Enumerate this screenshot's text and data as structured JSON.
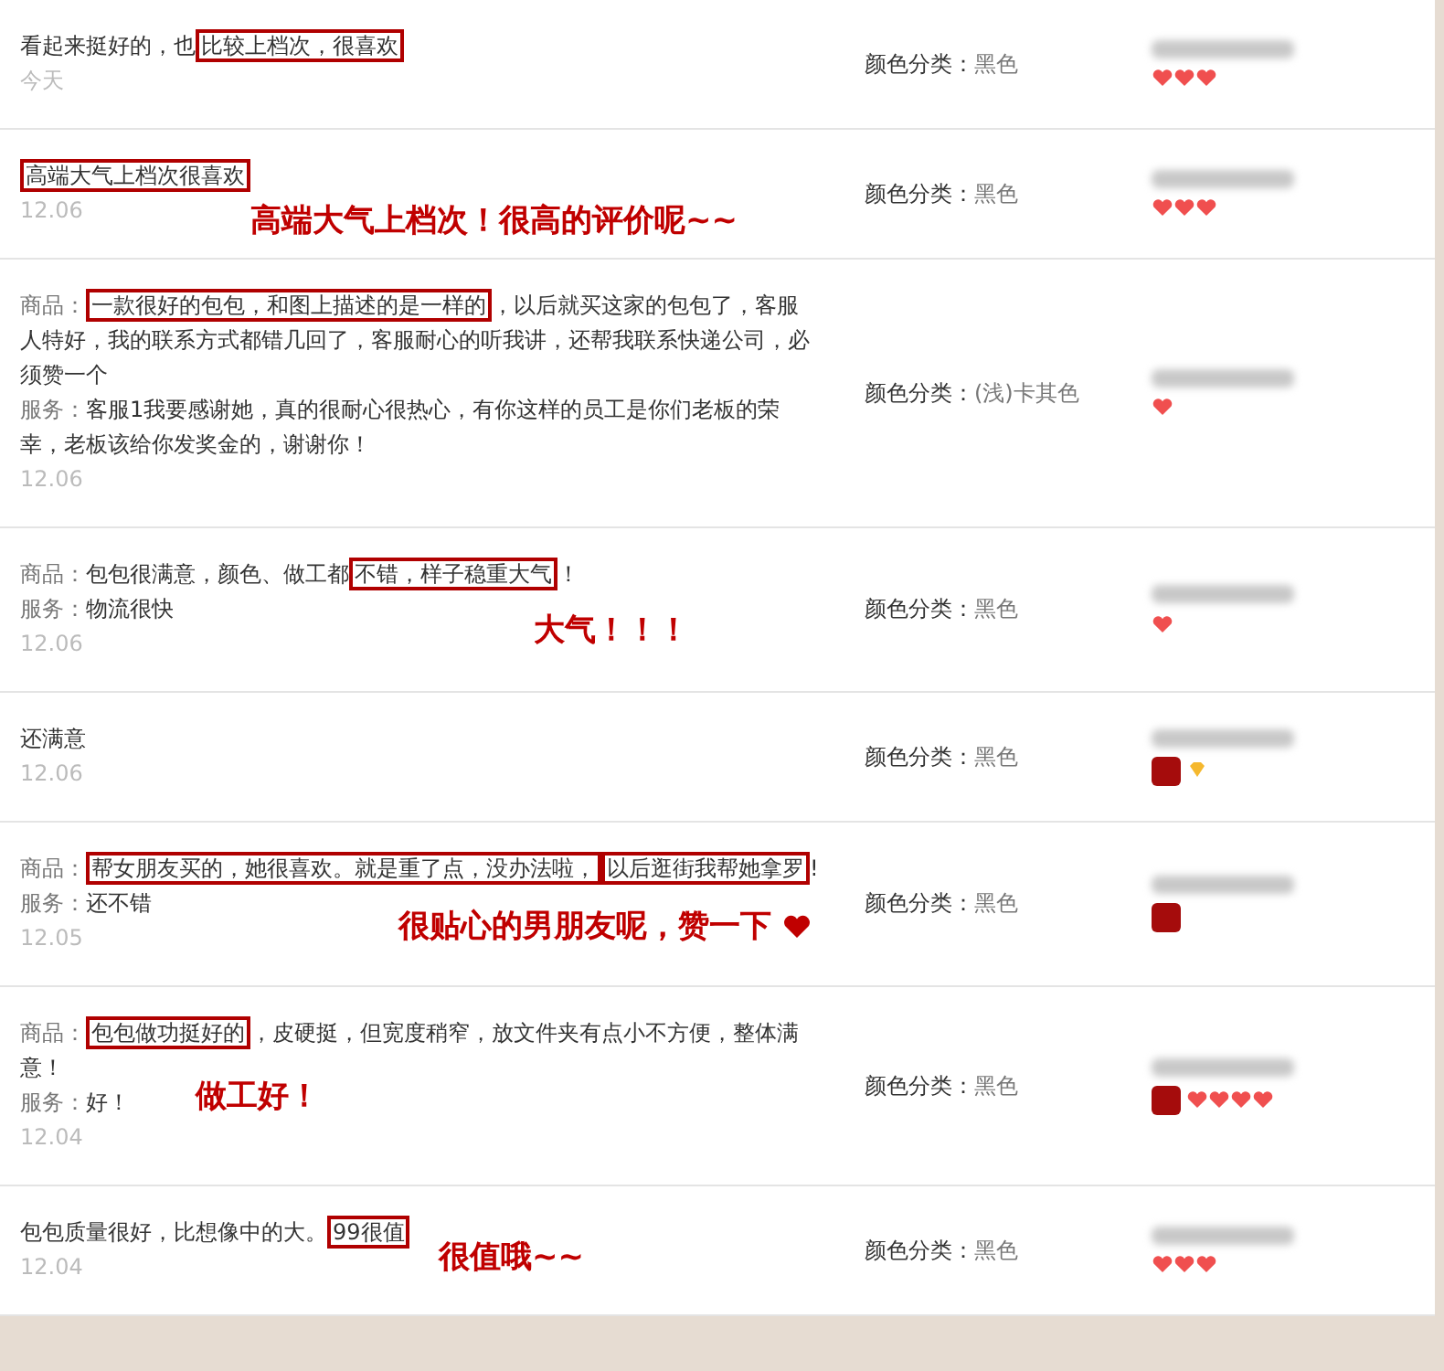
{
  "reviews": [
    {
      "segments": [
        {
          "text": "看起来挺好的，也"
        },
        {
          "text": "比较上档次，很喜欢",
          "boxed": true
        }
      ],
      "date": "今天",
      "color_label": "颜色分类：",
      "color_value": "黑色",
      "rank_icons": [
        {
          "kind": "heart"
        },
        {
          "kind": "heart"
        },
        {
          "kind": "heart"
        }
      ]
    },
    {
      "segments": [
        {
          "text": "高端大气上档次很喜欢",
          "boxed": true
        }
      ],
      "date": "12.06",
      "color_label": "颜色分类：",
      "color_value": "黑色",
      "rank_icons": [
        {
          "kind": "heart"
        },
        {
          "kind": "heart"
        },
        {
          "kind": "heart"
        }
      ],
      "annotation": {
        "text": "高端大气上档次！很高的评价呢~~"
      }
    },
    {
      "product_label": "商品：",
      "segments": [
        {
          "text": "一款很好的包包，和图上描述的是一样的",
          "boxed": true
        },
        {
          "text": "，以后就买这家的包包了，客服人特好，我的联系方式都错几回了，客服耐心的听我讲，还帮我联系快递公司，必须赞一个"
        }
      ],
      "service_label": "服务：",
      "service": "客服1我要感谢她，真的很耐心很热心，有你这样的员工是你们老板的荣幸，老板该给你发奖金的，谢谢你！",
      "date": "12.06",
      "color_label": "颜色分类：",
      "color_value": "(浅)卡其色",
      "rank_icons": [
        {
          "kind": "heart"
        }
      ]
    },
    {
      "product_label": "商品：",
      "segments": [
        {
          "text": "包包很满意，颜色、做工都"
        },
        {
          "text": "不错，样子稳重大气",
          "boxed": true
        },
        {
          "text": "！"
        }
      ],
      "service_label": "服务：",
      "service": "物流很快",
      "date": "12.06",
      "color_label": "颜色分类：",
      "color_value": "黑色",
      "rank_icons": [
        {
          "kind": "heart"
        }
      ],
      "annotation": {
        "text": "大气！！！"
      }
    },
    {
      "segments": [
        {
          "text": "还满意"
        }
      ],
      "date": "12.06",
      "color_label": "颜色分类：",
      "color_value": "黑色",
      "rank_icons": [
        {
          "kind": "vip"
        },
        {
          "kind": "diamond"
        }
      ]
    },
    {
      "product_label": "商品：",
      "segments": [
        {
          "text": "帮女朋友买的，她很喜欢。就是重了点，没办法啦，",
          "boxed": true
        },
        {
          "text": "以后逛街我帮她拿罗",
          "boxed": true
        },
        {
          "text": "!"
        }
      ],
      "service_label": "服务：",
      "service": "还不错",
      "date": "12.05",
      "color_label": "颜色分类：",
      "color_value": "黑色",
      "rank_icons": [
        {
          "kind": "vip"
        }
      ],
      "annotation": {
        "text": "很贴心的男朋友呢，赞一下",
        "heart": true
      }
    },
    {
      "product_label": "商品：",
      "segments": [
        {
          "text": "包包做功挺好的",
          "boxed": true
        },
        {
          "text": "，皮硬挺，但宽度稍窄，放文件夹有点小不方便，整体满意！"
        }
      ],
      "service_label": "服务：",
      "service": "好！",
      "date": "12.04",
      "color_label": "颜色分类：",
      "color_value": "黑色",
      "rank_icons": [
        {
          "kind": "vip"
        },
        {
          "kind": "heart"
        },
        {
          "kind": "heart"
        },
        {
          "kind": "heart"
        },
        {
          "kind": "heart"
        }
      ],
      "annotation": {
        "text": "做工好！"
      }
    },
    {
      "segments": [
        {
          "text": "包包质量很好，比想像中的大。"
        },
        {
          "text": "99很值",
          "boxed": true
        }
      ],
      "date": "12.04",
      "color_label": "颜色分类：",
      "color_value": "黑色",
      "rank_icons": [
        {
          "kind": "heart"
        },
        {
          "kind": "heart"
        },
        {
          "kind": "heart"
        }
      ],
      "annotation": {
        "text": "很值哦~~"
      }
    }
  ]
}
